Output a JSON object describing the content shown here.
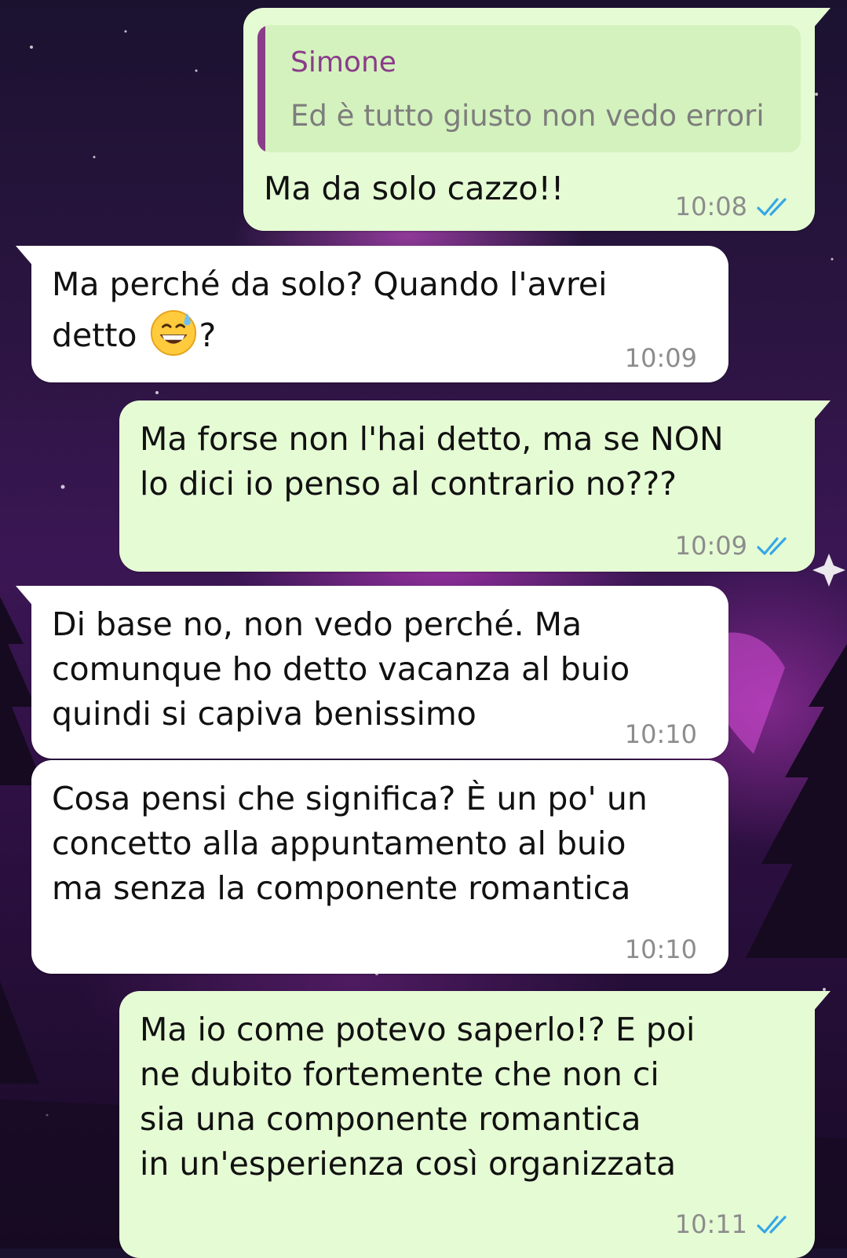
{
  "messages": [
    {
      "direction": "outgoing",
      "reply": {
        "author": "Simone",
        "text": "Ed è tutto giusto non vedo errori"
      },
      "lines": [
        "Ma da solo cazzo!!"
      ],
      "time": "10:08",
      "status": "read"
    },
    {
      "direction": "incoming",
      "lines": [
        "Ma perché da solo? Quando l'avrei",
        "detto",
        "?"
      ],
      "emoji": "grinning-face-with-sweat",
      "time": "10:09"
    },
    {
      "direction": "outgoing",
      "lines": [
        "Ma forse non l'hai detto, ma se NON",
        "lo dici io penso al contrario no???"
      ],
      "time": "10:09",
      "status": "read"
    },
    {
      "direction": "incoming",
      "lines": [
        "Di base no, non vedo perché. Ma",
        "comunque ho detto vacanza al buio",
        "quindi si capiva benissimo"
      ],
      "time": "10:10"
    },
    {
      "direction": "incoming",
      "lines": [
        "Cosa pensi che significa? È un po' un",
        "concetto alla appuntamento al buio",
        "ma senza la componente romantica"
      ],
      "time": "10:10"
    },
    {
      "direction": "outgoing",
      "lines": [
        "Ma io come potevo saperlo!? E poi",
        "ne dubito fortemente che non ci",
        "sia una componente romantica",
        "in un'esperienza così organizzata"
      ],
      "time": "10:11",
      "status": "read"
    }
  ],
  "colors": {
    "outgoing_bubble": "#e5fbd4",
    "incoming_bubble": "#ffffff",
    "quote_accent": "#8a3c8a",
    "read_ticks": "#35a7e6",
    "timestamp": "#8c8c8c"
  },
  "icons": {
    "read_receipt": "double-check-icon"
  }
}
